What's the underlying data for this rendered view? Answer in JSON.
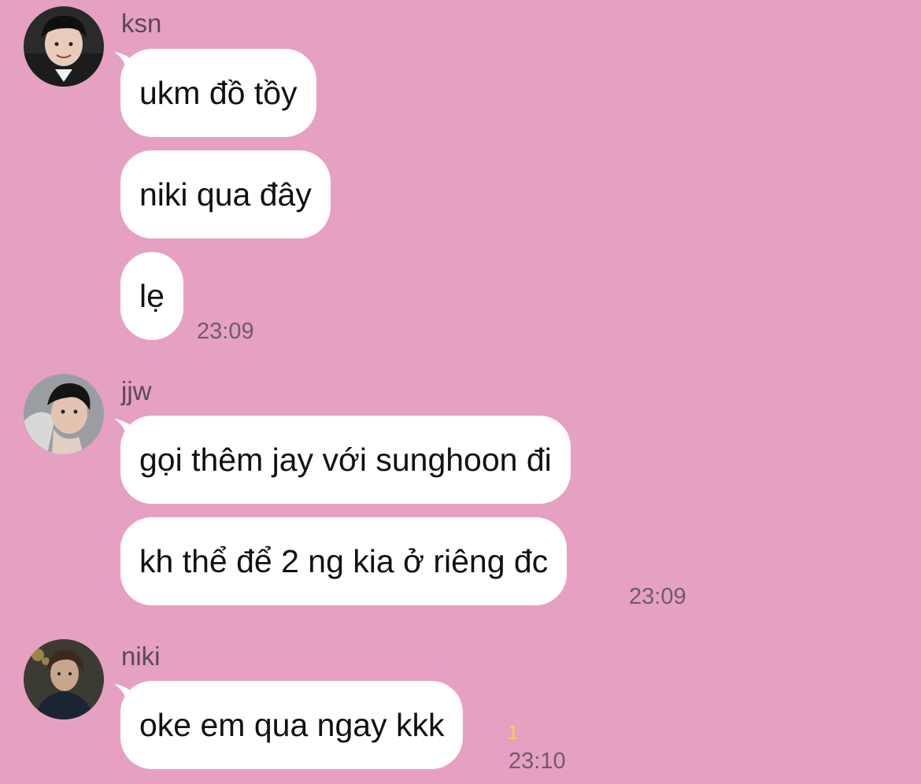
{
  "groups": [
    {
      "sender": "ksn",
      "messages": [
        "ukm đồ tồy",
        "niki qua đây",
        "lẹ"
      ],
      "time": "23:09"
    },
    {
      "sender": "jjw",
      "messages": [
        "gọi thêm jay với sunghoon đi",
        "kh thể để 2 ng kia ở riêng đc"
      ],
      "time": "23:09"
    },
    {
      "sender": "niki",
      "messages": [
        "oke em qua ngay kkk"
      ],
      "time": "23:10",
      "unread": "1"
    }
  ],
  "colors": {
    "background": "#e6a0c2",
    "bubble": "#ffffff",
    "unread": "#f5d442"
  }
}
